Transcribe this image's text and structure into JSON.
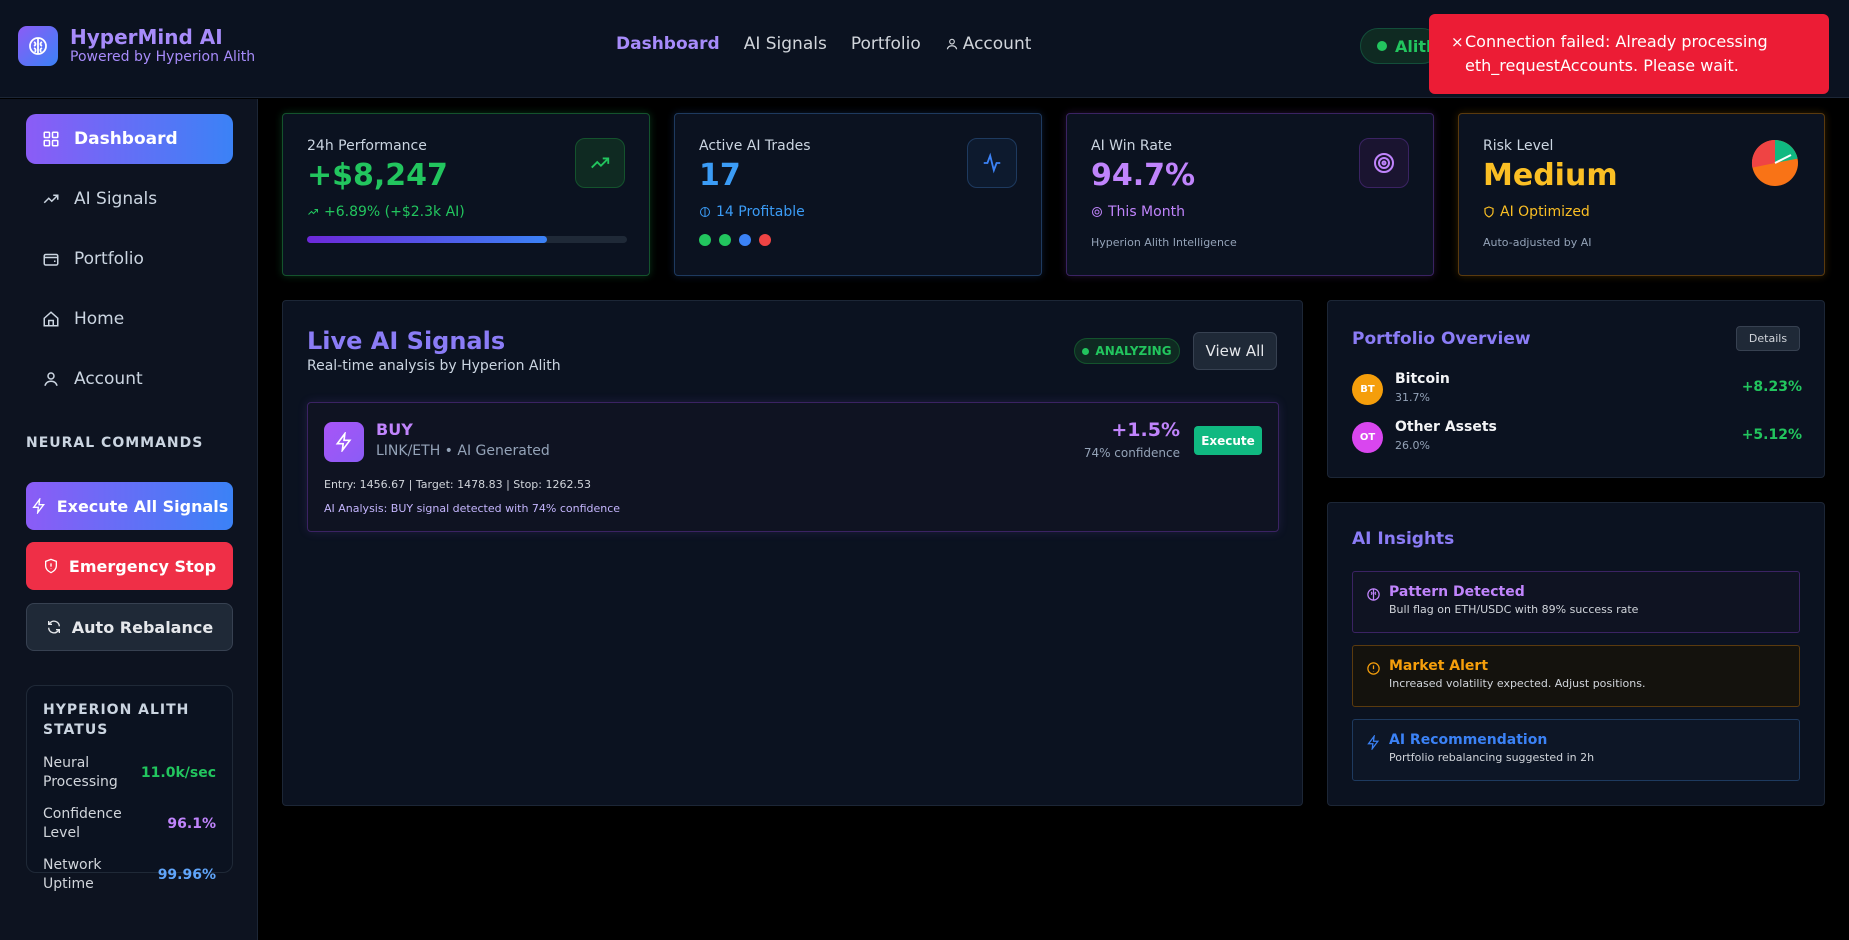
{
  "brand": {
    "title": "HyperMind AI",
    "subtitle": "Powered by Hyperion Alith"
  },
  "topnav": {
    "dashboard": "Dashboard",
    "signals": "AI Signals",
    "portfolio": "Portfolio",
    "account": "Account"
  },
  "wallet": {
    "label": "Alith"
  },
  "toast": {
    "close": "×",
    "message": "Connection failed: Already processing eth_requestAccounts. Please wait."
  },
  "sidebar": {
    "items": [
      {
        "label": "Dashboard",
        "icon": "grid-icon"
      },
      {
        "label": "AI Signals",
        "icon": "trending-up-icon"
      },
      {
        "label": "Portfolio",
        "icon": "wallet-icon"
      },
      {
        "label": "Home",
        "icon": "home-icon"
      },
      {
        "label": "Account",
        "icon": "user-icon"
      }
    ],
    "section_label": "NEURAL COMMANDS",
    "commands": {
      "execute": "Execute All Signals",
      "stop": "Emergency Stop",
      "rebalance": "Auto Rebalance"
    },
    "status": {
      "title": "HYPERION ALITH STATUS",
      "rows": [
        {
          "label": "Neural Processing",
          "value": "11.0k/sec",
          "color": "#22c55e"
        },
        {
          "label": "Confidence Level",
          "value": "96.1%",
          "color": "#c084fc"
        },
        {
          "label": "Network Uptime",
          "value": "99.96%",
          "color": "#60a5fa"
        }
      ]
    }
  },
  "cards": {
    "performance": {
      "label": "24h Performance",
      "value": "+$8,247",
      "sub": "+6.89% (+$2.3k AI)",
      "progress": 0.75
    },
    "trades": {
      "label": "Active AI Trades",
      "value": "17",
      "sub": "14 Profitable",
      "dots": [
        "#22c55e",
        "#22c55e",
        "#3b82f6",
        "#ef4444"
      ]
    },
    "winrate": {
      "label": "AI Win Rate",
      "value": "94.7%",
      "sub": "This Month",
      "note": "Hyperion Alith Intelligence"
    },
    "risk": {
      "label": "Risk Level",
      "value": "Medium",
      "sub": "AI Optimized",
      "note": "Auto-adjusted by AI"
    }
  },
  "signals": {
    "title": "Live AI Signals",
    "subtitle": "Real-time analysis by Hyperion Alith",
    "status": "ANALYZING",
    "view_all": "View All",
    "item": {
      "action": "BUY",
      "pair": "LINK/ETH • AI Generated",
      "change": "+1.5%",
      "confidence": "74% confidence",
      "execute": "Execute",
      "levels": "Entry: 1456.67 | Target: 1478.83 | Stop: 1262.53",
      "analysis": "AI Analysis: BUY signal detected with 74% confidence"
    }
  },
  "portfolio": {
    "title": "Portfolio Overview",
    "details": "Details",
    "assets": [
      {
        "abbr": "BT",
        "name": "Bitcoin",
        "pct": "31.7%",
        "change": "+8.23%",
        "color": "#f59e0b"
      },
      {
        "abbr": "OT",
        "name": "Other Assets",
        "pct": "26.0%",
        "change": "+5.12%",
        "color": "#d946ef"
      }
    ]
  },
  "insights": {
    "title": "AI Insights",
    "items": [
      {
        "title": "Pattern Detected",
        "desc": "Bull flag on ETH/USDC with 89% success rate",
        "icon": "brain-icon"
      },
      {
        "title": "Market Alert",
        "desc": "Increased volatility expected. Adjust positions.",
        "icon": "alert-circle-icon"
      },
      {
        "title": "AI Recommendation",
        "desc": "Portfolio rebalancing suggested in 2h",
        "icon": "lightning-icon"
      }
    ]
  }
}
